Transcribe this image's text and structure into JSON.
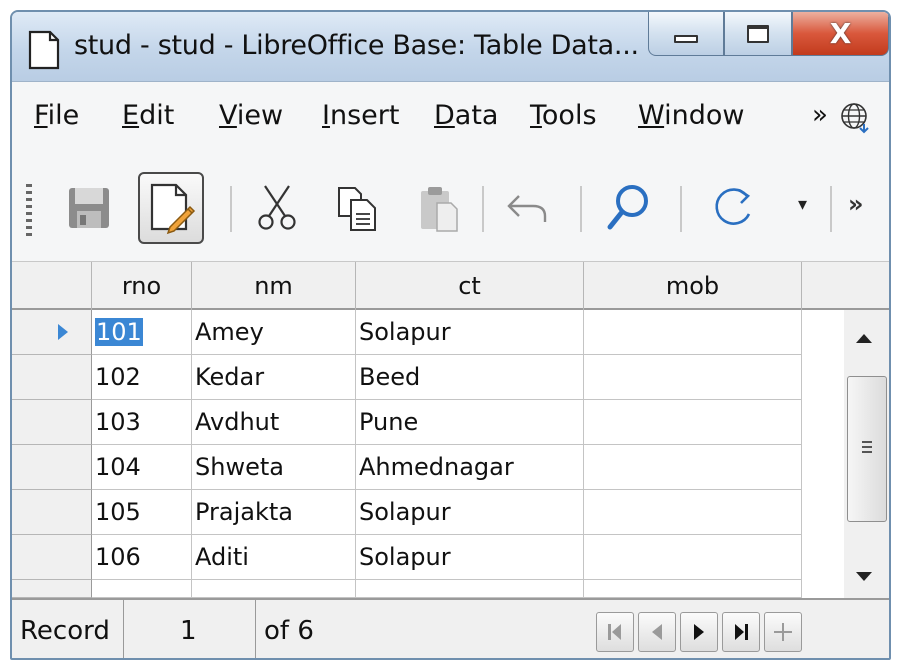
{
  "window": {
    "title": "stud - stud - LibreOffice Base: Table Data...",
    "close_glyph": "X"
  },
  "menu": {
    "items": [
      {
        "acc": "F",
        "rest": "ile"
      },
      {
        "acc": "E",
        "rest": "dit"
      },
      {
        "acc": "V",
        "rest": "iew"
      },
      {
        "acc": "I",
        "rest": "nsert"
      },
      {
        "acc": "D",
        "rest": "ata"
      },
      {
        "acc": "T",
        "rest": "ools"
      },
      {
        "acc": "W",
        "rest": "indow"
      }
    ],
    "more": "»"
  },
  "toolbar": {
    "more": "»",
    "drop": "▾",
    "icons": [
      "save-icon",
      "edit-data-icon",
      "cut-icon",
      "copy-icon",
      "paste-icon",
      "undo-icon",
      "find-icon",
      "refresh-icon"
    ]
  },
  "table": {
    "columns": [
      "rno",
      "nm",
      "ct",
      "mob"
    ],
    "rows": [
      {
        "rno": "101",
        "nm": "Amey",
        "ct": "Solapur",
        "mob": ""
      },
      {
        "rno": "102",
        "nm": "Kedar",
        "ct": "Beed",
        "mob": ""
      },
      {
        "rno": "103",
        "nm": "Avdhut",
        "ct": "Pune",
        "mob": ""
      },
      {
        "rno": "104",
        "nm": "Shweta",
        "ct": "Ahmednagar",
        "mob": ""
      },
      {
        "rno": "105",
        "nm": "Prajakta",
        "ct": "Solapur",
        "mob": ""
      },
      {
        "rno": "106",
        "nm": "Aditi",
        "ct": "Solapur",
        "mob": ""
      }
    ],
    "current_row": 0,
    "selection_color": "#3b87d4"
  },
  "record": {
    "label": "Record",
    "current": "1",
    "of_text": "of 6",
    "nav_icons": [
      "first-record-icon",
      "previous-record-icon",
      "next-record-icon",
      "last-record-icon",
      "new-record-icon"
    ]
  }
}
